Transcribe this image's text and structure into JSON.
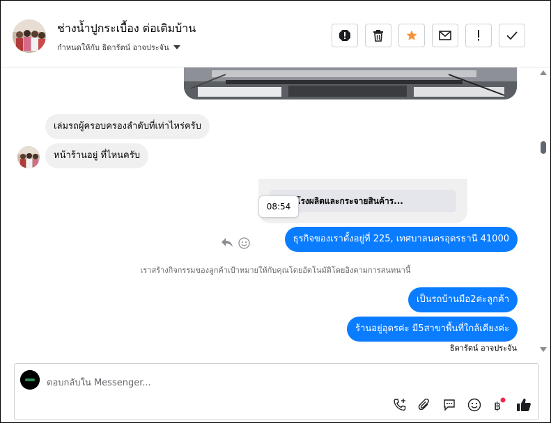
{
  "header": {
    "title": "ช่างน้ำปูกระเบื้อง ต่อเติมบ้าน",
    "assignee": "กำหนดให้กับ ธิดารัตน์ อาจประจัน",
    "actions": [
      "report-icon",
      "trash-icon",
      "star-icon",
      "mail-icon",
      "exclamation-icon",
      "check-icon"
    ]
  },
  "messages": {
    "incoming_1": "เล่มรถผู้ครอบครองลำดับที่เท่าไหร่ครับ",
    "incoming_2": "หน้าร้านอยู่ ที่ไหนครับ",
    "card_title": "โรงผลิตและกระจายสินค้าร...",
    "tooltip_time": "08:54",
    "outgoing_1": "ธุรกิจของเราตั้งอยู่ที่ 225, เทศบาลนครอุดรธานี 41000",
    "notice": "เราสร้างกิจกรรมของลูกค้าเป้าหมายให้กับคุณโดยอัตโนมัติโดยอิงตามการสนทนานี้",
    "outgoing_2": "เป็นรถบ้านมือ2ค่ะลูกค้า",
    "outgoing_3": "ร้านอยู่อุดรค่ะ มี5สาขาพื้นที่ใกล้เคียงค่ะ",
    "sender_name": "ธิดารัตน์ อาจประจัน"
  },
  "composer": {
    "placeholder": "ตอบกลับใน Messenger...",
    "tools": [
      "call-add-icon",
      "attachment-icon",
      "saved-reply-icon",
      "emoji-icon",
      "baht-payment-icon",
      "like-icon"
    ]
  },
  "colors": {
    "outgoing_bubble": "#0a7cff",
    "incoming_bubble": "#f0f0f0",
    "star": "#f7923a",
    "notification_dot": "#f02849"
  }
}
